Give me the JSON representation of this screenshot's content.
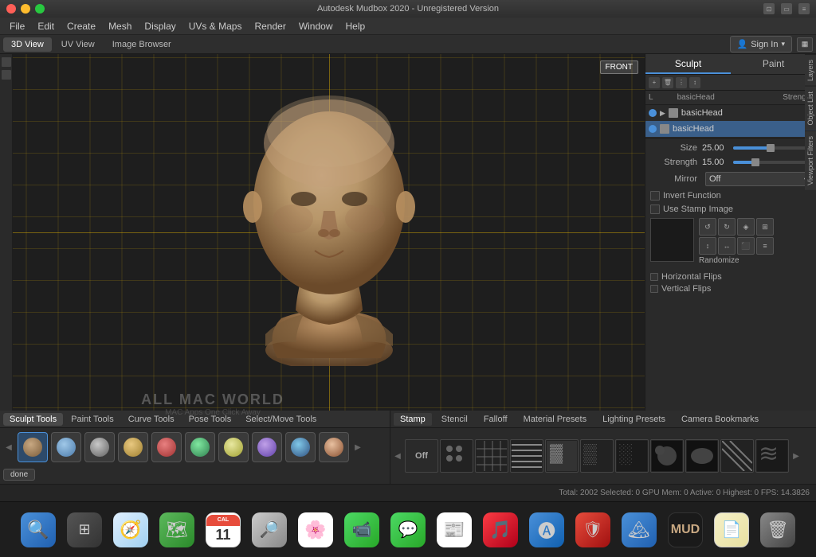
{
  "app": {
    "title": "Autodesk Mudbox 2020 - Unregistered Version",
    "name": "Mudbox"
  },
  "title_bar": {
    "right_icons": [
      "screen-icon",
      "window-icon",
      "more-icon"
    ]
  },
  "menu": {
    "items": [
      "File",
      "Edit",
      "Create",
      "Mesh",
      "Display",
      "UVs & Maps",
      "Render",
      "Window",
      "Help"
    ]
  },
  "tabs": {
    "views": [
      "3D View",
      "UV View",
      "Image Browser"
    ],
    "active": "3D View"
  },
  "sign_in": {
    "label": "Sign In"
  },
  "viewport": {
    "label": "FRONT"
  },
  "right_panel": {
    "sculpt_tab": "Sculpt",
    "paint_tab": "Paint",
    "layers": {
      "header_left": "L",
      "header_right": "Strength",
      "rows": [
        {
          "name": "basicHead",
          "type": "mesh",
          "selected": false
        },
        {
          "name": "basicHead",
          "type": "mesh",
          "selected": true
        }
      ]
    },
    "properties": {
      "size_label": "Size",
      "size_value": "25.00",
      "strength_label": "Strength",
      "strength_value": "15.00",
      "mirror_label": "Mirror",
      "mirror_value": "Off",
      "invert_label": "Invert Function",
      "stamp_label": "Use Stamp Image",
      "randomize_label": "Randomize",
      "h_flip_label": "Horizontal Flips",
      "v_flip_label": "Vertical Flips"
    }
  },
  "right_side_tabs": [
    "Layers",
    "Object List",
    "Viewport Filters"
  ],
  "tool_tabs": {
    "items": [
      "Sculpt Tools",
      "Paint Tools",
      "Curve Tools",
      "Pose Tools",
      "Select/Move Tools"
    ],
    "active": "Sculpt Tools"
  },
  "stamp_tabs": {
    "items": [
      "Stamp",
      "Stencil",
      "Falloff",
      "Material Presets",
      "Lighting Presets",
      "Camera Bookmarks"
    ],
    "active": "Stamp"
  },
  "sculpt_tools": [
    "sculpt",
    "smooth",
    "relax",
    "push",
    "paint",
    "flatten",
    "erase",
    "preset",
    "invert",
    "wax"
  ],
  "stamp_items": [
    "off",
    "dots",
    "grid1",
    "lines1",
    "dots2",
    "blotch1",
    "blotch2",
    "noise1",
    "noise2",
    "noise3",
    "lines2",
    "wave"
  ],
  "status_bar": {
    "text": "Total: 2002  Selected: 0  GPU Mem: 0  Active: 0  Highest: 0  FPS: 14.3826"
  },
  "dock": {
    "items": [
      {
        "name": "finder",
        "color": "#4a90d9",
        "label": ""
      },
      {
        "name": "launchpad",
        "color": "#e8e8e8",
        "label": ""
      },
      {
        "name": "safari",
        "color": "#4a90d9",
        "label": ""
      },
      {
        "name": "maps",
        "color": "#5cb85c",
        "label": ""
      },
      {
        "name": "calendar",
        "color": "#e74c3c",
        "label": "11"
      },
      {
        "name": "quicklook",
        "color": "#888",
        "label": ""
      },
      {
        "name": "photos",
        "color": "#e8a030",
        "label": ""
      },
      {
        "name": "facetime",
        "color": "#5cb85c",
        "label": ""
      },
      {
        "name": "messages",
        "color": "#5cb85c",
        "label": ""
      },
      {
        "name": "news",
        "color": "#e74c3c",
        "label": ""
      },
      {
        "name": "music",
        "color": "#e74c3c",
        "label": ""
      },
      {
        "name": "appstore",
        "color": "#4a90d9",
        "label": ""
      },
      {
        "name": "security",
        "color": "#e74c3c",
        "label": ""
      },
      {
        "name": "photos2",
        "color": "#4a90d9",
        "label": ""
      },
      {
        "name": "mudbox",
        "color": "#2c2c2c",
        "label": ""
      },
      {
        "name": "notes",
        "color": "#f0f0f0",
        "label": ""
      },
      {
        "name": "trash",
        "color": "#888",
        "label": ""
      }
    ]
  },
  "watermark": {
    "line1": "ALL MAC WORLD",
    "line2": "MAC Apps One Click Away"
  }
}
